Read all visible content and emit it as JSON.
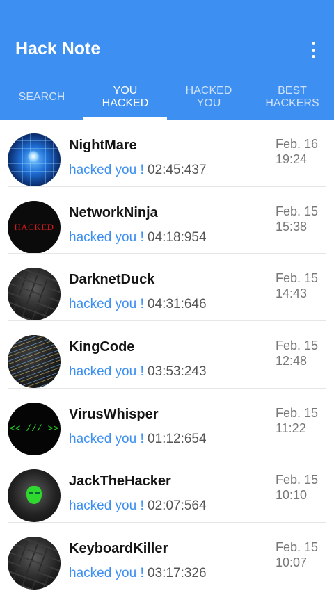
{
  "appbar": {
    "title": "Hack Note",
    "menu_icon": "more-vert-icon",
    "background": "#3d8ff1"
  },
  "tabs": [
    {
      "label": "SEARCH",
      "active": false
    },
    {
      "label": "YOU\nHACKED",
      "active": true
    },
    {
      "label": "HACKED\nYOU",
      "active": false
    },
    {
      "label": "BEST\nHACKERS",
      "active": false
    }
  ],
  "list": [
    {
      "name": "NightMare",
      "action": "hacked you ! ",
      "time": "02:45:437",
      "date": "Feb. 16\n19:24",
      "avatar": "globe-network-avatar"
    },
    {
      "name": "NetworkNinja",
      "action": "hacked you ! ",
      "time": "04:18:954",
      "date": "Feb. 15\n15:38",
      "avatar": "hacked-text-avatar",
      "avatar_text": "HACKED"
    },
    {
      "name": "DarknetDuck",
      "action": "hacked you ! ",
      "time": "04:31:646",
      "date": "Feb. 15\n14:43",
      "avatar": "keyboard-avatar"
    },
    {
      "name": "KingCode",
      "action": "hacked you ! ",
      "time": "03:53:243",
      "date": "Feb. 15\n12:48",
      "avatar": "code-screen-avatar"
    },
    {
      "name": "VirusWhisper",
      "action": "hacked you ! ",
      "time": "01:12:654",
      "date": "Feb. 15\n11:22",
      "avatar": "code-symbol-avatar",
      "avatar_text": "<< /// >>"
    },
    {
      "name": "JackTheHacker",
      "action": "hacked you ! ",
      "time": "02:07:564",
      "date": "Feb. 15\n10:10",
      "avatar": "hooded-mask-avatar"
    },
    {
      "name": "KeyboardKiller",
      "action": "hacked you ! ",
      "time": "03:17:326",
      "date": "Feb. 15\n10:07",
      "avatar": "keyboard-avatar"
    }
  ]
}
